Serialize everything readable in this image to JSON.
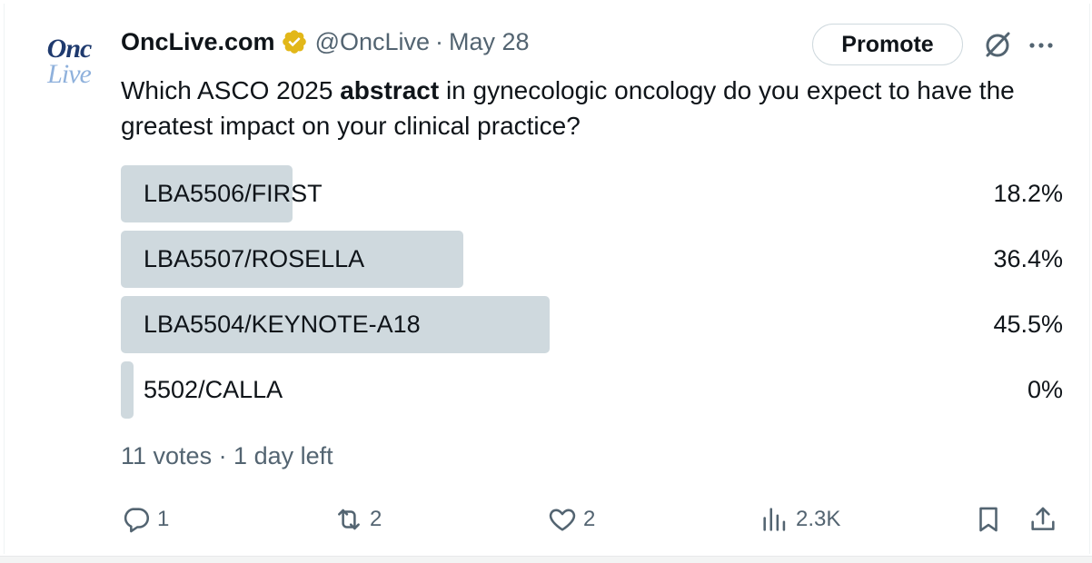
{
  "header": {
    "display_name": "OncLive.com",
    "handle": "@OncLive",
    "separator": "·",
    "date": "May 28",
    "promote_label": "Promote"
  },
  "logo": {
    "line1": "Onc",
    "line2": "Live"
  },
  "tweet": {
    "text_before": "Which ASCO 2025 ",
    "text_bold": "abstract",
    "text_after": " in gynecologic oncology do you expect to have the greatest impact on your clinical practice?"
  },
  "poll": {
    "options": [
      {
        "label": "LBA5506/FIRST",
        "percent_label": "18.2%",
        "percent": 18.2
      },
      {
        "label": "LBA5507/ROSELLA",
        "percent_label": "36.4%",
        "percent": 36.4
      },
      {
        "label": "LBA5504/KEYNOTE-A18",
        "percent_label": "45.5%",
        "percent": 45.5
      },
      {
        "label": "5502/CALLA",
        "percent_label": "0%",
        "percent": 0
      }
    ],
    "meta": "11 votes · 1 day left"
  },
  "actions": {
    "replies": "1",
    "reposts": "2",
    "likes": "2",
    "views": "2.3K"
  },
  "icons": {
    "verified": "verified-badge-icon",
    "grok": "grok-icon",
    "more": "more-icon",
    "reply": "reply-icon",
    "repost": "repost-icon",
    "like": "heart-icon",
    "views": "views-icon",
    "bookmark": "bookmark-icon",
    "share": "share-icon"
  },
  "colors": {
    "text": "#0f1419",
    "secondary": "#536471",
    "poll_bar": "#cfd9de",
    "verified_gold": "#e2b719",
    "logo_dark": "#1f3a6e",
    "logo_light": "#8fb1dc"
  }
}
